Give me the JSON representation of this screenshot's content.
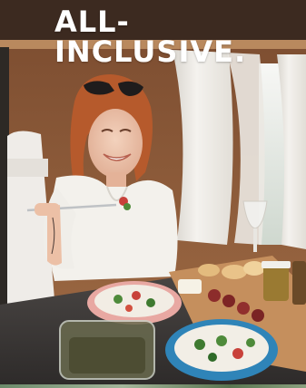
{
  "headline": {
    "text": "ALL-\nINCLUSIVE."
  },
  "photo": {
    "subject": "woman-eating-in-camper-van",
    "dominant_colors": {
      "wood": "#8a5a3a",
      "curtain": "#efece6",
      "blouse": "#f3f1ec",
      "hair": "#b8592a",
      "table": "#3d3a38",
      "bowl_blue": "#2f84b8",
      "bowl_pink": "#e7a5a0"
    }
  }
}
